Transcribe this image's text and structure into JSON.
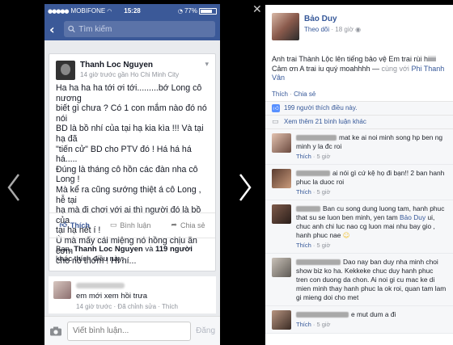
{
  "phone": {
    "status": {
      "carrier": "MOBIFONE",
      "time": "15:28",
      "battery": "77%",
      "battery_level": 0.77
    },
    "search": {
      "placeholder": "Tìm kiếm"
    },
    "post": {
      "author": "Thanh Loc Nguyen",
      "meta": "14 giờ trước gần Ho Chi Minh City",
      "lines": [
        "Ha ha ha ha tới ơi tới.........bớ Long cô nương",
        "biết gì chưa ? Có 1 con mắm nào đó nó nói",
        "BD là bồ nhí của tại hạ kia kìa !!! Và tại hạ đã",
        "\"tiến cử\" BD cho PTV đó ! Há há há há.....",
        "Đúng là tháng cô hồn các đàn nha cô Long !",
        "Mà kể ra cũng sướng thiệt á cô Long , hễ tại",
        "hạ mà đi chơi với ai thì người đó là bồ của",
        "tại hạ hết í !",
        "Ù mà mấy cái miệng nó hồng chịu ăn cơm",
        "cho nó thơm ! Hí hí..."
      ],
      "actions": {
        "like": "Thích",
        "comment": "Bình luận",
        "share": "Chia sẻ"
      },
      "likes": {
        "you": "Bạn,",
        "name": "Thanh Loc Nguyen",
        "and": "và",
        "count": "119 người",
        "rest": "khác thích điều này."
      }
    },
    "comment": {
      "text": "em mới xem hồi trưa",
      "meta": "14 giờ trước · Đã chỉnh sửa · Thích"
    },
    "composer": {
      "placeholder": "Viết bình luận...",
      "send": "Đăng"
    }
  },
  "panel": {
    "name": "Bảo Duy",
    "follow": "Theo dõi",
    "time": "18 giờ",
    "text": "Anh trai Thành Lộc lên tiếng bảo vệ Em trai rùi hiiiii Cảm ơn A trai iu quý moahhhh —",
    "with": "cùng với",
    "tag": "Phi Thanh Vân",
    "actions": {
      "like": "Thích",
      "share": "Chia sẻ"
    },
    "summary": {
      "likes": "199 người thích điều này.",
      "more": "Xem thêm 21 bình luận khác"
    },
    "comments": [
      {
        "text": "mat ke ai noi minh song hp ben ng minh y la đc roi",
        "meta": "· 5 giờ"
      },
      {
        "text": "ai nói gì cứ kệ họ đi bạn!! 2 ban hanh phuc la duoc roi",
        "meta": "· 5 giờ"
      },
      {
        "text": "Ban cu song dung luong tam, hanh phuc that su se luon ben minh, yen tam",
        "tag": "Bảo Duy",
        "text2": "ui, chuc anh chi luc nao cg luon mai nhu bay gio , hanh phuc nae",
        "meta": "· 5 giờ"
      },
      {
        "text": "Dao nay ban duy nha minh choi show biz ko ha. Kekkeke chuc duy hanh phuc tren con duong da chon. Ai noi gi cu mac ke di mien minh thay hanh phuc la ok roi, quan tam lam gi mieng doi cho met",
        "meta": ""
      },
      {
        "text": "e mut dum a đi",
        "meta": "· 5 giờ"
      }
    ]
  }
}
